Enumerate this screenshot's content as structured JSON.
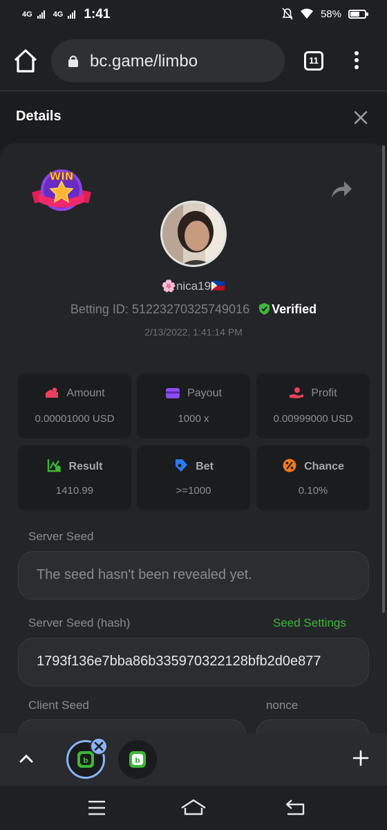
{
  "status_bar": {
    "network1": "4G",
    "network2": "4G",
    "time": "1:41",
    "battery_pct": "58%",
    "battery_level": 0.58
  },
  "browser": {
    "url": "bc.game/limbo",
    "tab_count": "11"
  },
  "panel": {
    "title": "Details"
  },
  "bet": {
    "badge": "WIN",
    "username": "🌸nica19🇵🇭",
    "betting_id_label": "Betting ID:",
    "betting_id": "51223270325749016",
    "verified": "Verified",
    "datetime": "2/13/2022, 1:41:14 PM"
  },
  "stats": [
    {
      "label": "Amount",
      "value": "0.00001000 USD",
      "icon": "amount-icon",
      "color": "#e8425c"
    },
    {
      "label": "Payout",
      "value": "1000 x",
      "icon": "wallet-icon",
      "color": "#8d4cf0"
    },
    {
      "label": "Profit",
      "value": "0.00999000 USD",
      "icon": "profit-hand-icon",
      "color": "#e8425c"
    },
    {
      "label": "Result",
      "value": "1410.99",
      "icon": "chart-check-icon",
      "color": "#3fb53a"
    },
    {
      "label": "Bet",
      "value": ">=1000",
      "icon": "tag-icon",
      "color": "#2f7af0"
    },
    {
      "label": "Chance",
      "value": "0.10%",
      "icon": "percent-icon",
      "color": "#f07a22"
    }
  ],
  "server_seed": {
    "label": "Server Seed",
    "value": "The seed hasn't been revealed yet."
  },
  "server_seed_hash": {
    "label": "Server Seed (hash)",
    "link": "Seed Settings",
    "value": "1793f136e7bba86b335970322128bfb2d0e877"
  },
  "client_seed": {
    "label": "Client Seed"
  },
  "nonce": {
    "label": "nonce"
  },
  "colors": {
    "accent_green": "#3fb53a",
    "background": "#1b1c1e",
    "card": "#242528"
  }
}
